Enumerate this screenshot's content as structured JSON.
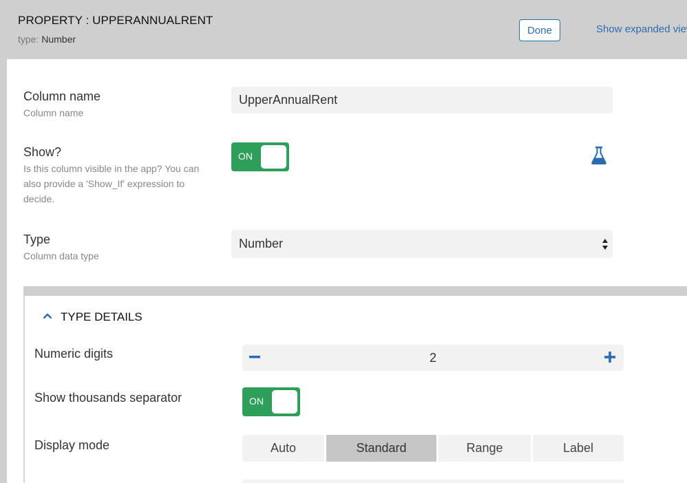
{
  "header": {
    "title": "PROPERTY : UPPERANNUALRENT",
    "type_label": "type:",
    "type_value": "Number",
    "done_label": "Done",
    "expanded_link": "Show expanded view"
  },
  "column_name": {
    "label": "Column name",
    "sublabel": "Column name",
    "value": "UpperAnnualRent"
  },
  "show": {
    "label": "Show?",
    "sublabel": "Is this column visible in the app? You can also provide a 'Show_If' expression to decide.",
    "toggle_text": "ON",
    "state": true,
    "expression_icon": "flask-icon"
  },
  "type": {
    "label": "Type",
    "sublabel": "Column data type",
    "value": "Number"
  },
  "type_details": {
    "title": "TYPE DETAILS",
    "numeric_digits": {
      "label": "Numeric digits",
      "value": "2"
    },
    "thousands_separator": {
      "label": "Show thousands separator",
      "toggle_text": "ON",
      "state": true
    },
    "display_mode": {
      "label": "Display mode",
      "options": [
        "Auto",
        "Standard",
        "Range",
        "Label"
      ],
      "selected": "Standard"
    }
  },
  "colors": {
    "accent_blue": "#2b6cb0",
    "toggle_green": "#2e9e5b",
    "header_gray": "#cfcfcf"
  }
}
